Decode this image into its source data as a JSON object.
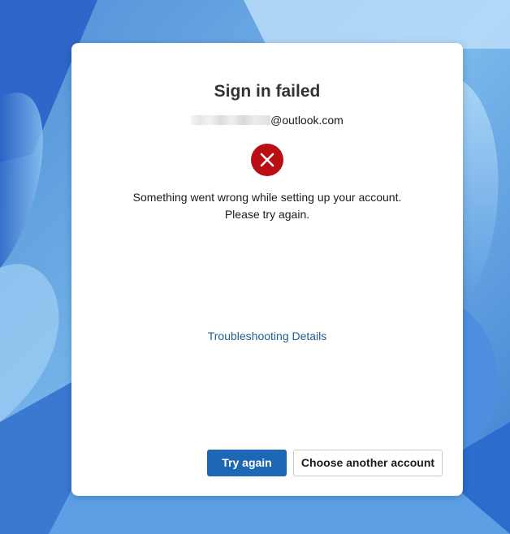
{
  "dialog": {
    "title": "Sign in failed",
    "account_suffix": "@outlook.com",
    "message": "Something went wrong while setting up your account. Please try again.",
    "troubleshooting_link": "Troubleshooting Details",
    "error_icon": "error-x-circle-icon"
  },
  "buttons": {
    "try_again": "Try again",
    "choose_another": "Choose another account"
  },
  "colors": {
    "primary": "#1e67b4",
    "error": "#b80e14",
    "link": "#1d5f97"
  }
}
